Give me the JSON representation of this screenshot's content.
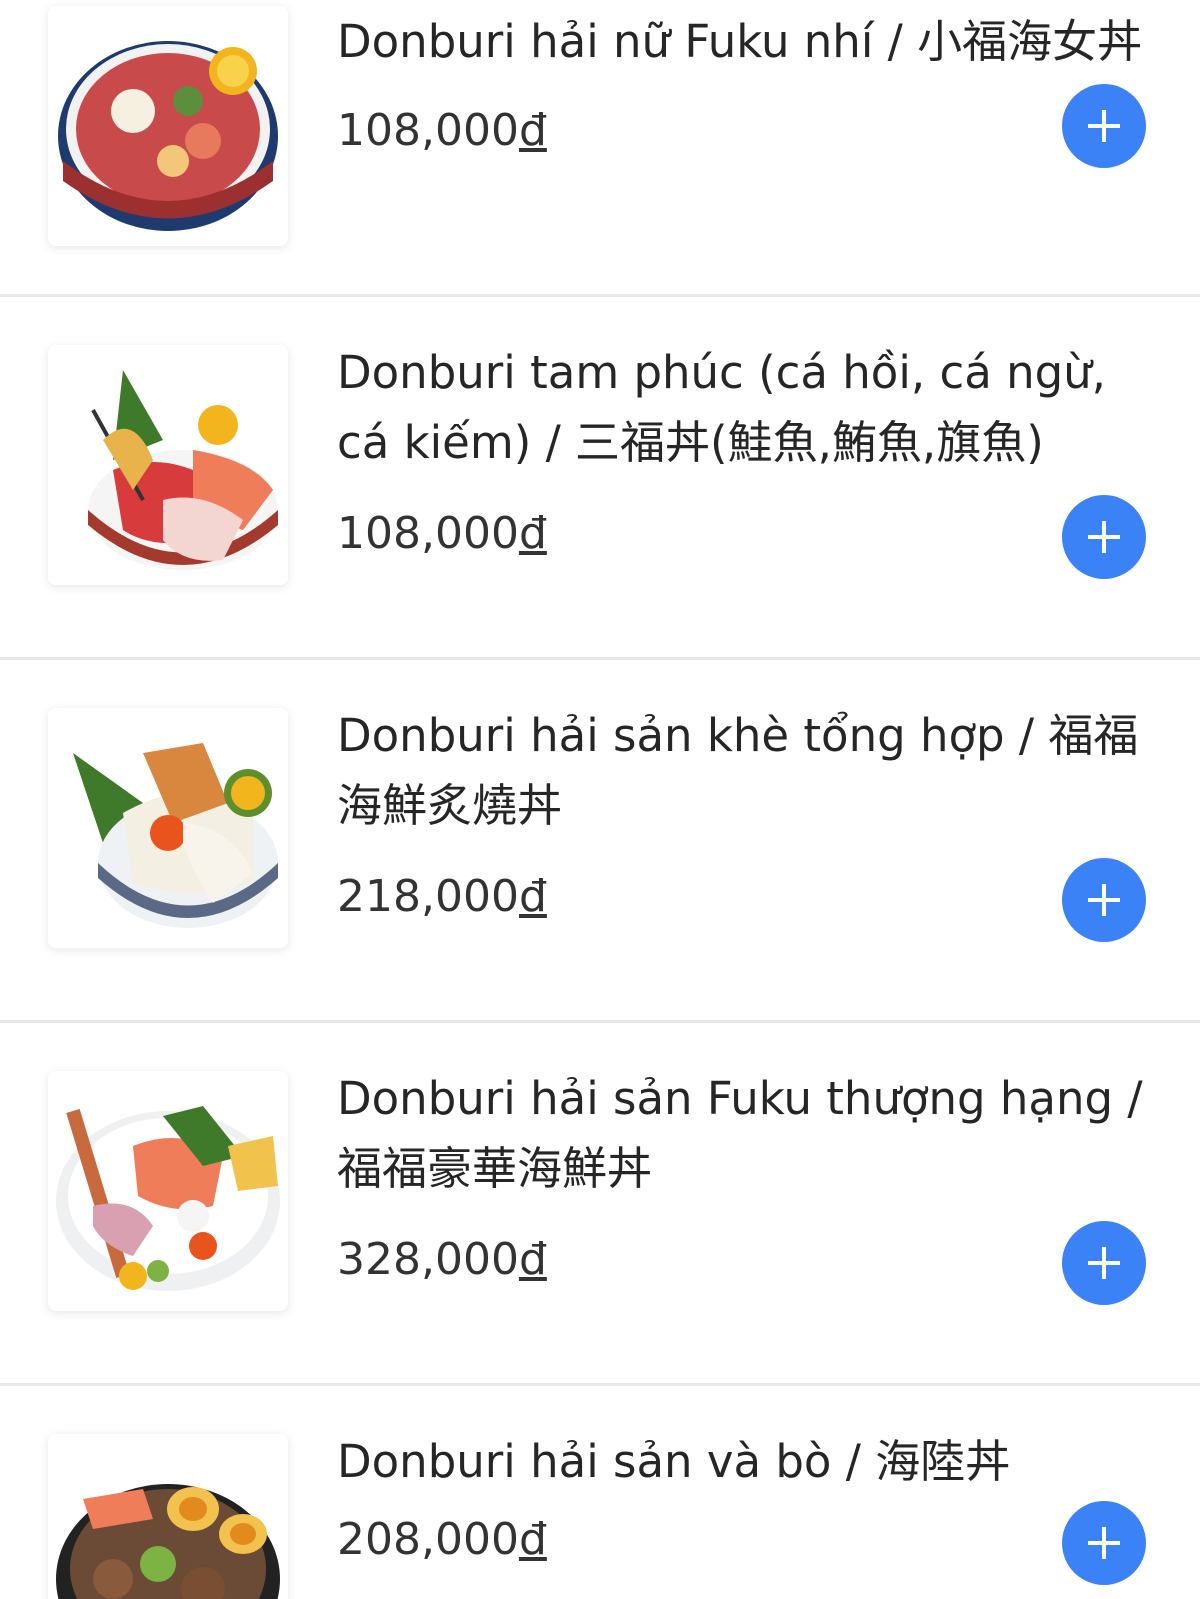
{
  "accent_color": "#3b82f6",
  "currency_symbol": "đ",
  "items": [
    {
      "name": "Donburi hải nữ Fuku nhí / 小福海女丼",
      "price": "108,000",
      "image": "seafood-rice-bowl-image"
    },
    {
      "name": "Donburi tam phúc (cá hồi, cá ngừ, cá kiếm) / 三福丼(鮭魚,鮪魚,旗魚)",
      "price": "108,000",
      "image": "sashimi-rice-bowl-image"
    },
    {
      "name": "Donburi hải sản khè tổng hợp / 福福海鮮炙燒丼",
      "price": "218,000",
      "image": "seared-seafood-bowl-image"
    },
    {
      "name": "Donburi hải sản Fuku thượng hạng / 福福豪華海鮮丼",
      "price": "328,000",
      "image": "premium-seafood-bowl-image"
    },
    {
      "name": "Donburi hải sản và bò / 海陸丼",
      "price": "208,000",
      "image": "surf-and-turf-bowl-image"
    }
  ]
}
